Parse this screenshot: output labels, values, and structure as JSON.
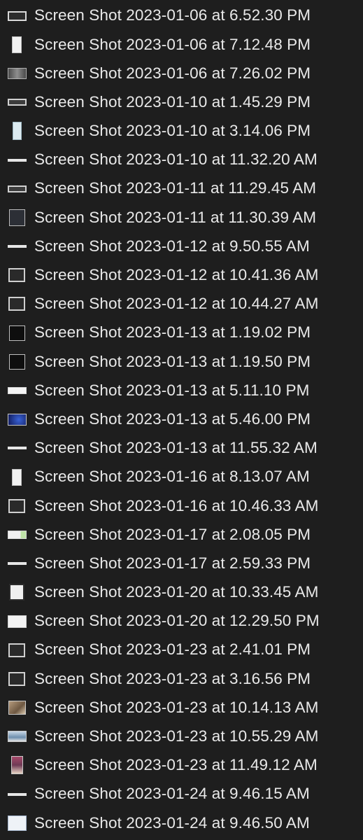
{
  "files": [
    {
      "name": "Screen Shot 2023-01-06 at 6.52.30 PM",
      "thumb": "wide"
    },
    {
      "name": "Screen Shot 2023-01-06 at 7.12.48 PM",
      "thumb": "tall"
    },
    {
      "name": "Screen Shot 2023-01-06 at 7.26.02 PM",
      "thumb": "gray"
    },
    {
      "name": "Screen Shot 2023-01-10 at 1.45.29 PM",
      "thumb": "flat"
    },
    {
      "name": "Screen Shot 2023-01-10 at 3.14.06 PM",
      "thumb": "tallb"
    },
    {
      "name": "Screen Shot 2023-01-10 at 11.32.20 AM",
      "thumb": "line"
    },
    {
      "name": "Screen Shot 2023-01-11 at 11.29.45 AM",
      "thumb": "flat"
    },
    {
      "name": "Screen Shot 2023-01-11 at 11.30.39 AM",
      "thumb": "darksq"
    },
    {
      "name": "Screen Shot 2023-01-12 at 9.50.55 AM",
      "thumb": "line"
    },
    {
      "name": "Screen Shot 2023-01-12 at 10.41.36 AM",
      "thumb": "dark"
    },
    {
      "name": "Screen Shot 2023-01-12 at 10.44.27 AM",
      "thumb": "dark"
    },
    {
      "name": "Screen Shot 2023-01-13 at 1.19.02 PM",
      "thumb": "term"
    },
    {
      "name": "Screen Shot 2023-01-13 at 1.19.50 PM",
      "thumb": "term"
    },
    {
      "name": "Screen Shot 2023-01-13 at 5.11.10 PM",
      "thumb": "white"
    },
    {
      "name": "Screen Shot 2023-01-13 at 5.46.00 PM",
      "thumb": "blue"
    },
    {
      "name": "Screen Shot 2023-01-13 at 11.55.32 AM",
      "thumb": "line"
    },
    {
      "name": "Screen Shot 2023-01-16 at 8.13.07 AM",
      "thumb": "tall"
    },
    {
      "name": "Screen Shot 2023-01-16 at 10.46.33 AM",
      "thumb": "dark"
    },
    {
      "name": "Screen Shot 2023-01-17 at 2.08.05 PM",
      "thumb": "green"
    },
    {
      "name": "Screen Shot 2023-01-17 at 2.59.33 PM",
      "thumb": "line"
    },
    {
      "name": "Screen Shot 2023-01-20 at 10.33.45 AM",
      "thumb": "sq"
    },
    {
      "name": "Screen Shot 2023-01-20 at 12.29.50 PM",
      "thumb": "whiteb"
    },
    {
      "name": "Screen Shot 2023-01-23 at 2.41.01 PM",
      "thumb": "dark"
    },
    {
      "name": "Screen Shot 2023-01-23 at 3.16.56 PM",
      "thumb": "dark"
    },
    {
      "name": "Screen Shot 2023-01-23 at 10.14.13 AM",
      "thumb": "photo"
    },
    {
      "name": "Screen Shot 2023-01-23 at 10.55.29 AM",
      "thumb": "land"
    },
    {
      "name": "Screen Shot 2023-01-23 at 11.49.12 AM",
      "thumb": "card"
    },
    {
      "name": "Screen Shot 2023-01-24 at 9.46.15 AM",
      "thumb": "line"
    },
    {
      "name": "Screen Shot 2023-01-24 at 9.46.50 AM",
      "thumb": "page"
    }
  ]
}
